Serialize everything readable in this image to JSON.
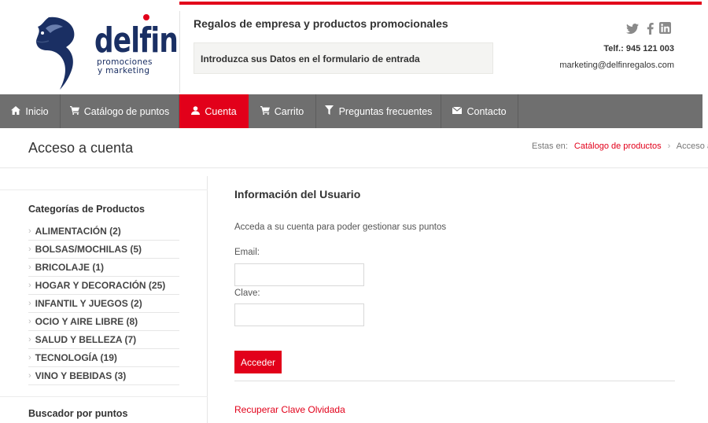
{
  "brand": {
    "logo_name": "delfin",
    "logo_sub1": "promociones",
    "logo_sub2": "y marketing",
    "accent_color": "#e2001a",
    "logo_color": "#1a2f63"
  },
  "header": {
    "slogan": "Regalos de empresa y productos promocionales",
    "notice": "Introduzca sus Datos en el formulario de entrada",
    "phone": "Telf.: 945 121 003",
    "email": "marketing@delfinregalos.com",
    "social": [
      "twitter-icon",
      "facebook-icon",
      "linkedin-icon"
    ]
  },
  "nav": {
    "items": [
      {
        "label": "Inicio",
        "icon": "home-icon"
      },
      {
        "label": "Catálogo de puntos",
        "icon": "cart-icon"
      },
      {
        "label": "Cuenta",
        "icon": "user-icon"
      },
      {
        "label": "Carrito",
        "icon": "cart-icon"
      },
      {
        "label": "Preguntas frecuentes",
        "icon": "filter-icon"
      },
      {
        "label": "Contacto",
        "icon": "envelope-icon"
      }
    ],
    "active": "Cuenta"
  },
  "titlebar": {
    "title": "Acceso a cuenta",
    "breadcrumb_prefix": "Estas en:",
    "breadcrumb_link": "Catálogo de productos",
    "breadcrumb_current": "Acceso a"
  },
  "sidebar": {
    "categories_title": "Categorías de Productos",
    "categories": [
      "ALIMENTACIÓN (2)",
      "BOLSAS/MOCHILAS (5)",
      "BRICOLAJE (1)",
      "HOGAR Y DECORACIÓN (25)",
      "INFANTIL Y JUEGOS (2)",
      "OCIO Y AIRE LIBRE (8)",
      "SALUD Y BELLEZA (7)",
      "TECNOLOGÍA (19)",
      "VINO Y BEBIDAS (3)"
    ],
    "search_title": "Buscador por puntos"
  },
  "main": {
    "section_title": "Información del Usuario",
    "intro": "Acceda a su cuenta para poder gestionar sus puntos",
    "email_label": "Email:",
    "email_value": "",
    "password_label": "Clave:",
    "password_value": "",
    "submit_label": "Acceder",
    "recover_link": "Recuperar Clave Olvidada"
  }
}
